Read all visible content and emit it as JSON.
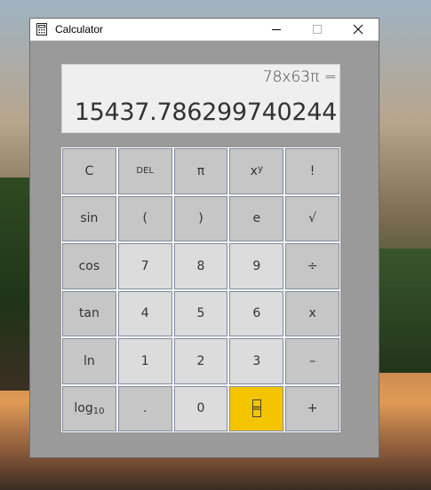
{
  "window": {
    "title": "Calculator",
    "icon": "calculator-icon",
    "controls": [
      "minimize-icon",
      "maximize-icon",
      "close-icon"
    ]
  },
  "display": {
    "expression": "78x63π =",
    "result": "15437.786299740244"
  },
  "keys": [
    {
      "label": "C",
      "name": "clear-button",
      "kind": "func"
    },
    {
      "label": "DEL",
      "name": "delete-button",
      "kind": "func-small"
    },
    {
      "label": "π",
      "name": "pi-button",
      "kind": "func"
    },
    {
      "base": "x",
      "sup": "y",
      "name": "power-button",
      "kind": "pow"
    },
    {
      "label": "!",
      "name": "factorial-button",
      "kind": "func"
    },
    {
      "label": "sin",
      "name": "sin-button",
      "kind": "func"
    },
    {
      "label": "(",
      "name": "open-paren-button",
      "kind": "func"
    },
    {
      "label": ")",
      "name": "close-paren-button",
      "kind": "func"
    },
    {
      "label": "e",
      "name": "e-button",
      "kind": "func"
    },
    {
      "label": "√",
      "name": "sqrt-button",
      "kind": "func"
    },
    {
      "label": "cos",
      "name": "cos-button",
      "kind": "func"
    },
    {
      "label": "7",
      "name": "digit-7-button",
      "kind": "digit"
    },
    {
      "label": "8",
      "name": "digit-8-button",
      "kind": "digit"
    },
    {
      "label": "9",
      "name": "digit-9-button",
      "kind": "digit"
    },
    {
      "label": "÷",
      "name": "divide-button",
      "kind": "func"
    },
    {
      "label": "tan",
      "name": "tan-button",
      "kind": "func"
    },
    {
      "label": "4",
      "name": "digit-4-button",
      "kind": "digit"
    },
    {
      "label": "5",
      "name": "digit-5-button",
      "kind": "digit"
    },
    {
      "label": "6",
      "name": "digit-6-button",
      "kind": "digit"
    },
    {
      "label": "x",
      "name": "multiply-button",
      "kind": "func"
    },
    {
      "label": "ln",
      "name": "ln-button",
      "kind": "func"
    },
    {
      "label": "1",
      "name": "digit-1-button",
      "kind": "digit"
    },
    {
      "label": "2",
      "name": "digit-2-button",
      "kind": "digit"
    },
    {
      "label": "3",
      "name": "digit-3-button",
      "kind": "digit"
    },
    {
      "label": "–",
      "name": "subtract-button",
      "kind": "func"
    },
    {
      "base": "log",
      "sub": "10",
      "name": "log10-button",
      "kind": "log"
    },
    {
      "label": ".",
      "name": "decimal-button",
      "kind": "func"
    },
    {
      "label": "0",
      "name": "digit-0-button",
      "kind": "digit"
    },
    {
      "label": "=",
      "name": "equals-button",
      "kind": "equals"
    },
    {
      "label": "+",
      "name": "add-button",
      "kind": "func"
    }
  ],
  "colors": {
    "equals": "#f5c400",
    "func_key": "#c6c6c6",
    "digit_key": "#dcdcdc",
    "window_bg": "#9a9a9a"
  }
}
